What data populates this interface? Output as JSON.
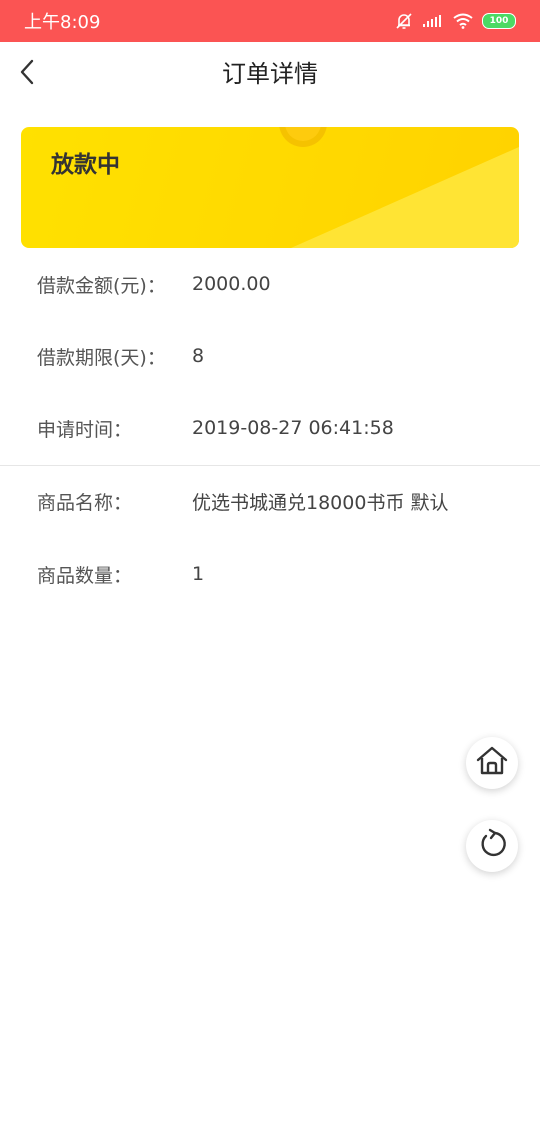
{
  "status_bar": {
    "time": "上午8:09",
    "battery": "100"
  },
  "header": {
    "title": "订单详情"
  },
  "order_status": {
    "text": "放款中"
  },
  "loan_info": [
    {
      "label": "借款金额(元)：",
      "value": "2000.00"
    },
    {
      "label": "借款期限(天)：",
      "value": "8"
    },
    {
      "label": "申请时间：",
      "value": "2019-08-27 06:41:58"
    }
  ],
  "product_info": [
    {
      "label": "商品名称：",
      "value": "优选书城通兑18000书币 默认"
    },
    {
      "label": "商品数量：",
      "value": "1"
    }
  ],
  "colors": {
    "status_bar": "#fb5453",
    "card_yellow": "#ffdd00"
  },
  "icons": {
    "back": "back-arrow-icon",
    "home": "home-icon",
    "refresh": "refresh-icon"
  }
}
